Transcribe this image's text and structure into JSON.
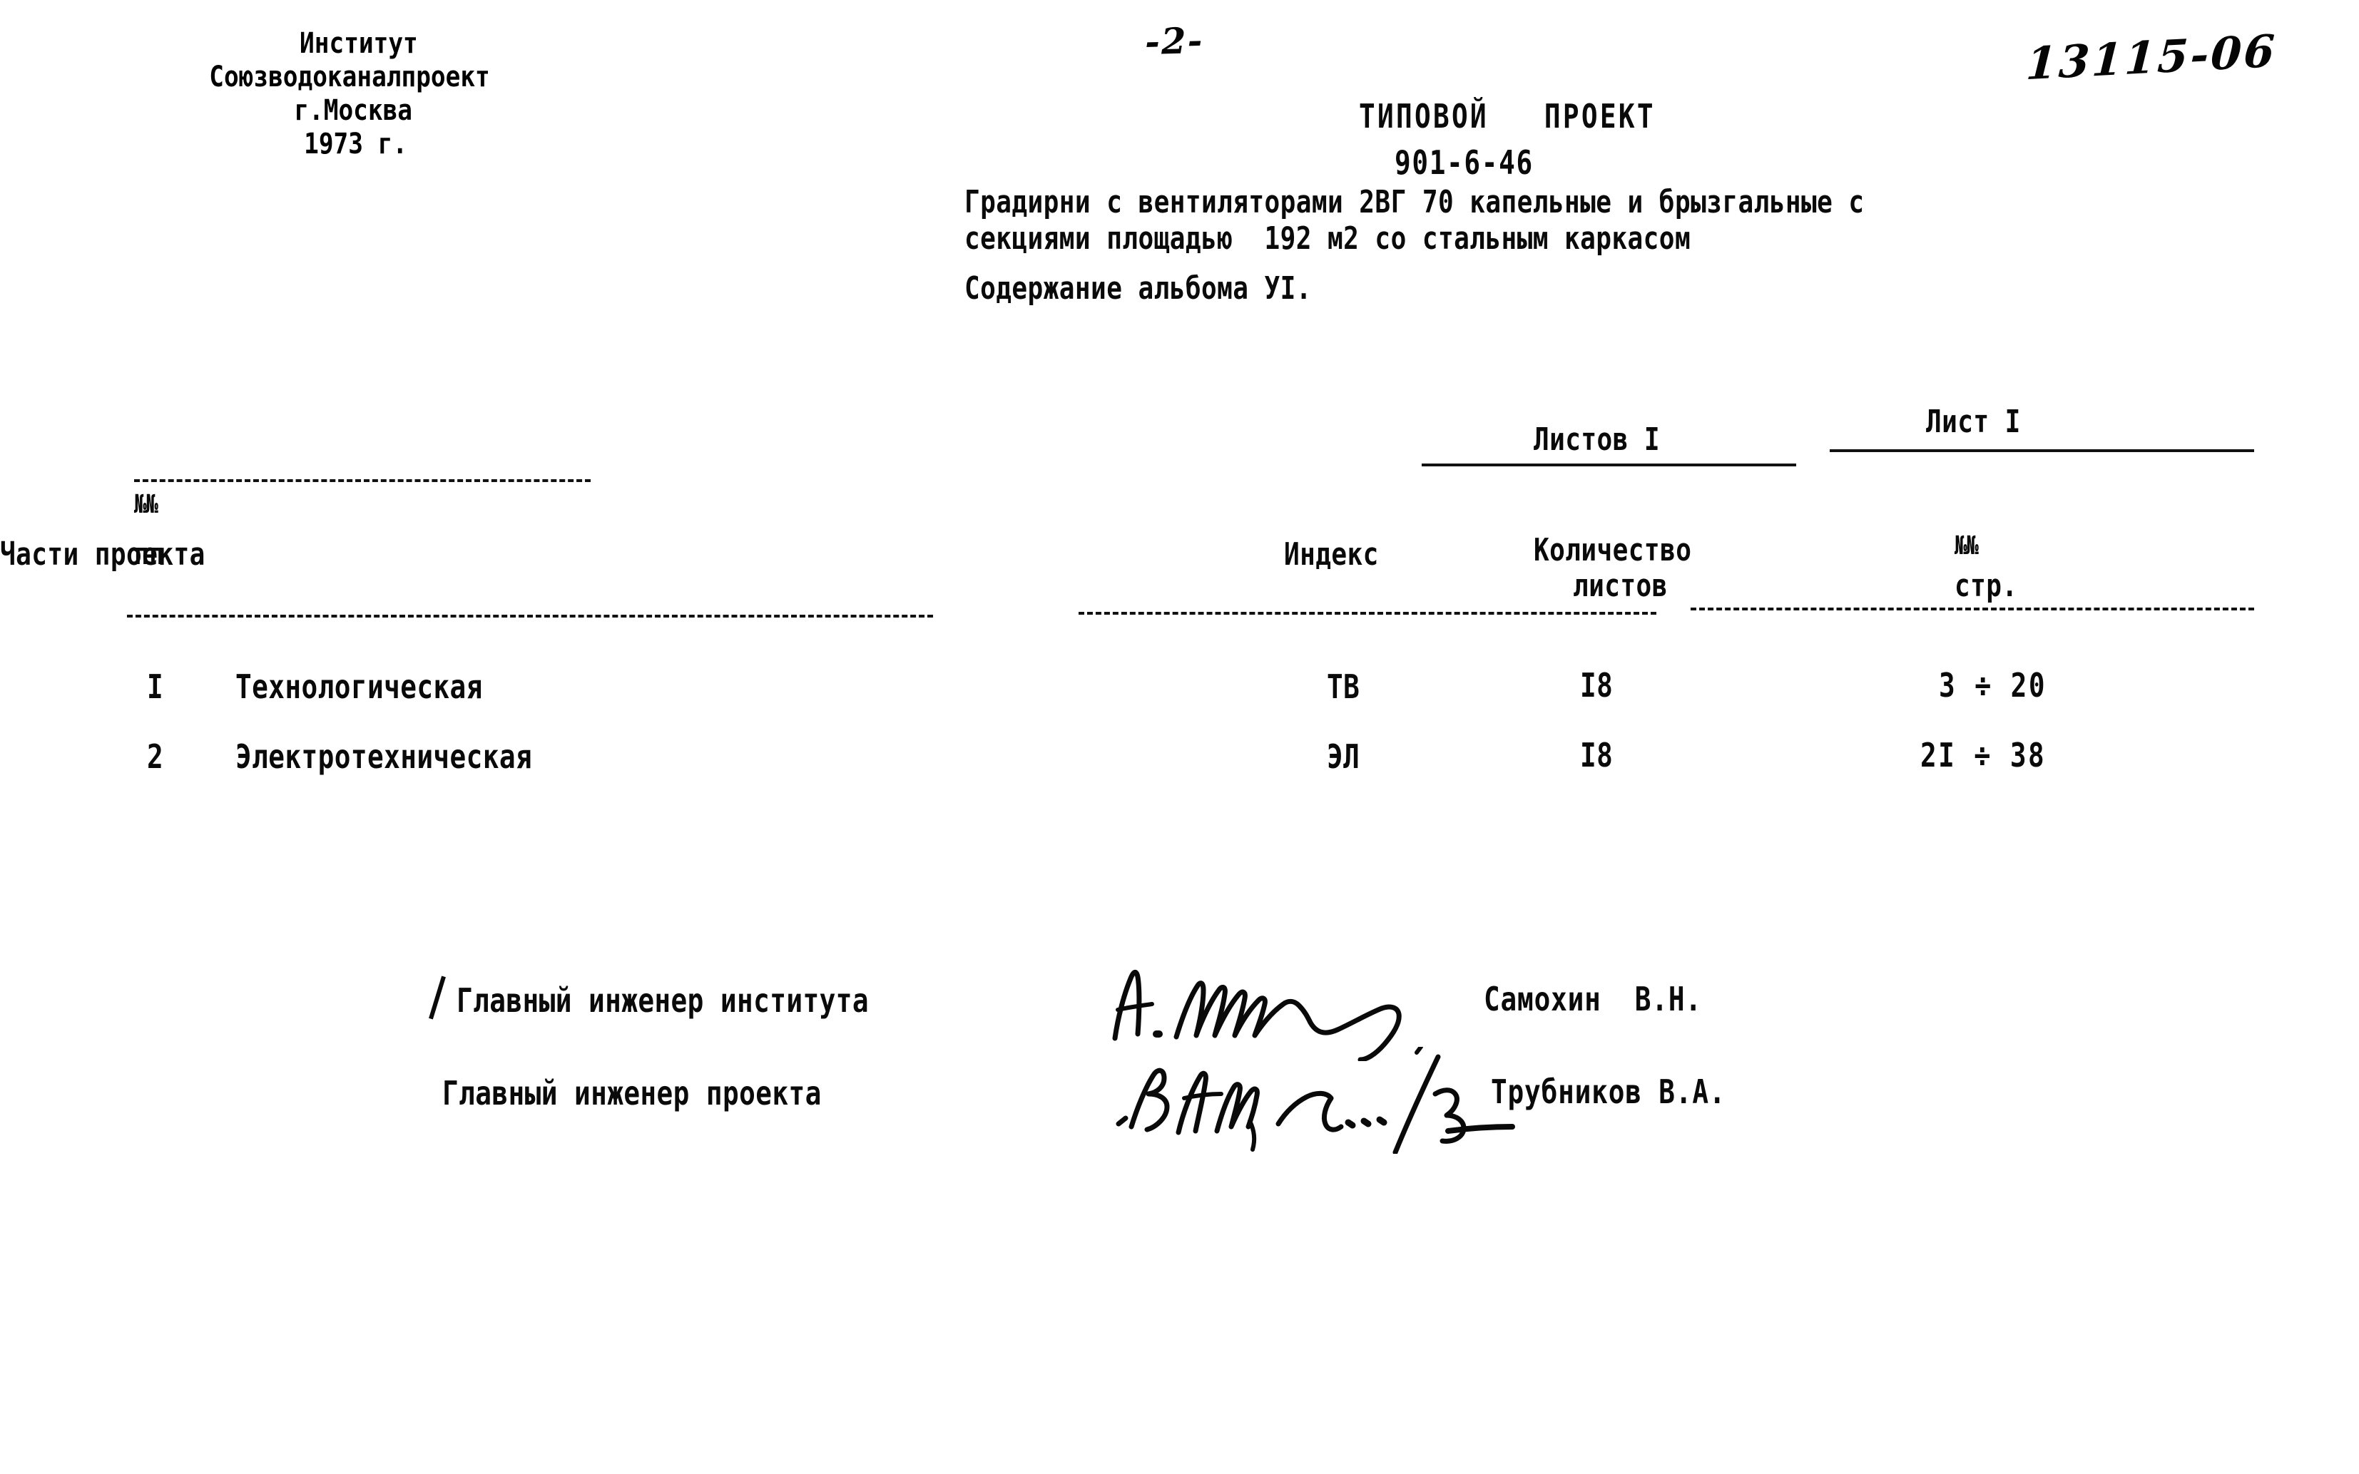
{
  "document": {
    "page_number": "-2-",
    "archive_number": "13115-06"
  },
  "organisation": {
    "line1": "Институт",
    "line2": "Союзводоканалпроект",
    "line3": "г.Москва",
    "line4": "1973 г."
  },
  "title": {
    "heading": "ТИПОВОЙ   ПРОЕКТ",
    "code": "901-6-46",
    "description_line1": "Градирни с вентиляторами 2ВГ 70 капельные и брызгальные с",
    "description_line2": "секциями площадью  192 м2 со стальным каркасом",
    "contents": "Содержание альбома УI."
  },
  "sheet_info": {
    "total_label": "Листов I",
    "current_label": "Лист I"
  },
  "table": {
    "headers": {
      "no_symbol": "№№",
      "no_sub": "пп",
      "parts": "Части проекта",
      "index": "Индекс",
      "qty_line1": "Количество",
      "qty_line2": "листов",
      "page_symbol": "№№",
      "page_sub": "стр."
    },
    "rows": [
      {
        "no": "I",
        "name": "Технологическая",
        "index": "ТВ",
        "qty": "I8",
        "pages": "3 ÷ 20"
      },
      {
        "no": "2",
        "name": "Электротехническая",
        "index": "ЭЛ",
        "qty": "I8",
        "pages": "2I ÷ 38"
      }
    ]
  },
  "signatures": [
    {
      "role": "Главный инженер института",
      "name": "Самохин  В.Н.",
      "signature": "handwritten-signature"
    },
    {
      "role": "Главный инженер проекта",
      "name": "Трубников В.А.",
      "signature": "handwritten-signature"
    }
  ],
  "colors": {
    "ink": "#0a0a0a",
    "paper": "#ffffff"
  }
}
